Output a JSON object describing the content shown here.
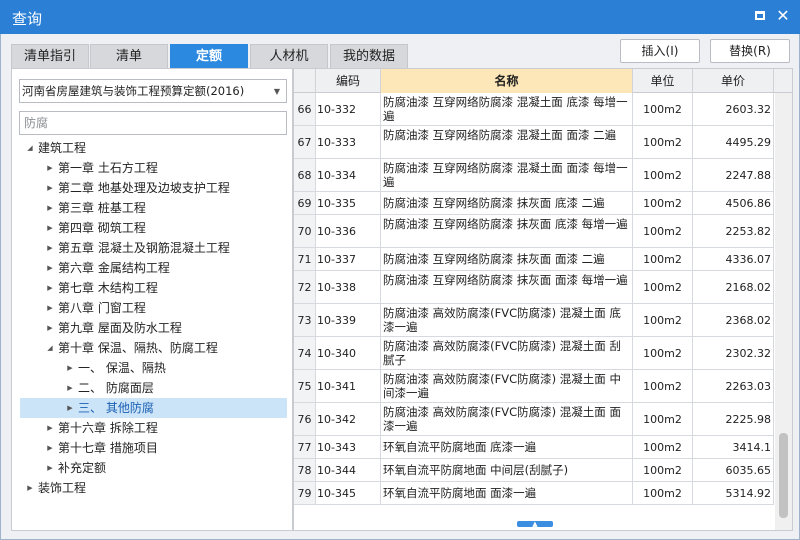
{
  "window": {
    "title": "查询"
  },
  "tabs": [
    {
      "label": "清单指引"
    },
    {
      "label": "清单"
    },
    {
      "label": "定额"
    },
    {
      "label": "人材机"
    },
    {
      "label": "我的数据"
    }
  ],
  "active_tab": "定额",
  "actions": {
    "insert_label": "插入(I)",
    "replace_label": "替换(R)"
  },
  "quota_library": {
    "selected": "河南省房屋建筑与装饰工程预算定额(2016)"
  },
  "search": {
    "value": "防腐",
    "placeholder": "防腐"
  },
  "tree": [
    {
      "label": "建筑工程",
      "level": 0,
      "state": "expanded"
    },
    {
      "label": "第一章  土石方工程",
      "level": 1,
      "state": "collapsed"
    },
    {
      "label": "第二章  地基处理及边坡支护工程",
      "level": 1,
      "state": "collapsed"
    },
    {
      "label": "第三章  桩基工程",
      "level": 1,
      "state": "collapsed"
    },
    {
      "label": "第四章  砌筑工程",
      "level": 1,
      "state": "collapsed"
    },
    {
      "label": "第五章  混凝土及钢筋混凝土工程",
      "level": 1,
      "state": "collapsed"
    },
    {
      "label": "第六章  金属结构工程",
      "level": 1,
      "state": "collapsed"
    },
    {
      "label": "第七章  木结构工程",
      "level": 1,
      "state": "collapsed"
    },
    {
      "label": "第八章  门窗工程",
      "level": 1,
      "state": "collapsed"
    },
    {
      "label": "第九章  屋面及防水工程",
      "level": 1,
      "state": "collapsed"
    },
    {
      "label": "第十章  保温、隔热、防腐工程",
      "level": 1,
      "state": "expanded"
    },
    {
      "label": "一、  保温、隔热",
      "level": 2,
      "state": "collapsed"
    },
    {
      "label": "二、  防腐面层",
      "level": 2,
      "state": "collapsed"
    },
    {
      "label": "三、  其他防腐",
      "level": 2,
      "state": "collapsed",
      "selected": true
    },
    {
      "label": "第十六章  拆除工程",
      "level": 1,
      "state": "collapsed"
    },
    {
      "label": "第十七章  措施项目",
      "level": 1,
      "state": "collapsed"
    },
    {
      "label": "补充定额",
      "level": 1,
      "state": "collapsed"
    },
    {
      "label": "装饰工程",
      "level": 0,
      "state": "collapsed"
    }
  ],
  "grid": {
    "headers": {
      "code": "编码",
      "name": "名称",
      "unit": "单位",
      "price": "单价"
    },
    "rows": [
      {
        "num": "66",
        "code": "10-332",
        "name": "防腐油漆 互穿网络防腐漆 混凝土面 底漆 每增一遍",
        "unit": "100m2",
        "price": "2603.32"
      },
      {
        "num": "67",
        "code": "10-333",
        "name": "防腐油漆 互穿网络防腐漆 混凝土面 面漆 二遍",
        "unit": "100m2",
        "price": "4495.29"
      },
      {
        "num": "68",
        "code": "10-334",
        "name": "防腐油漆 互穿网络防腐漆 混凝土面 面漆 每增一遍",
        "unit": "100m2",
        "price": "2247.88"
      },
      {
        "num": "69",
        "code": "10-335",
        "name": "防腐油漆 互穿网络防腐漆 抹灰面 底漆 二遍",
        "unit": "100m2",
        "price": "4506.86"
      },
      {
        "num": "70",
        "code": "10-336",
        "name": "防腐油漆 互穿网络防腐漆 抹灰面 底漆 每增一遍",
        "unit": "100m2",
        "price": "2253.82"
      },
      {
        "num": "71",
        "code": "10-337",
        "name": "防腐油漆 互穿网络防腐漆 抹灰面 面漆 二遍",
        "unit": "100m2",
        "price": "4336.07"
      },
      {
        "num": "72",
        "code": "10-338",
        "name": "防腐油漆 互穿网络防腐漆 抹灰面 面漆 每增一遍",
        "unit": "100m2",
        "price": "2168.02"
      },
      {
        "num": "73",
        "code": "10-339",
        "name": "防腐油漆 高效防腐漆(FVC防腐漆) 混凝土面 底漆一遍",
        "unit": "100m2",
        "price": "2368.02"
      },
      {
        "num": "74",
        "code": "10-340",
        "name": "防腐油漆 高效防腐漆(FVC防腐漆) 混凝土面 刮腻子",
        "unit": "100m2",
        "price": "2302.32"
      },
      {
        "num": "75",
        "code": "10-341",
        "name": "防腐油漆 高效防腐漆(FVC防腐漆) 混凝土面 中间漆一遍",
        "unit": "100m2",
        "price": "2263.03"
      },
      {
        "num": "76",
        "code": "10-342",
        "name": "防腐油漆 高效防腐漆(FVC防腐漆) 混凝土面 面漆一遍",
        "unit": "100m2",
        "price": "2225.98"
      },
      {
        "num": "77",
        "code": "10-343",
        "name": "环氧自流平防腐地面 底漆一遍",
        "unit": "100m2",
        "price": "3414.1"
      },
      {
        "num": "78",
        "code": "10-344",
        "name": "环氧自流平防腐地面 中间层(刮腻子)",
        "unit": "100m2",
        "price": "6035.65"
      },
      {
        "num": "79",
        "code": "10-345",
        "name": "环氧自流平防腐地面 面漆一遍",
        "unit": "100m2",
        "price": "5314.92"
      }
    ]
  },
  "colors": {
    "accent": "#2b7fd4",
    "tab_active": "#2b8ae0",
    "header_highlight": "#fde7b8",
    "tree_selected": "#cce4f7"
  }
}
